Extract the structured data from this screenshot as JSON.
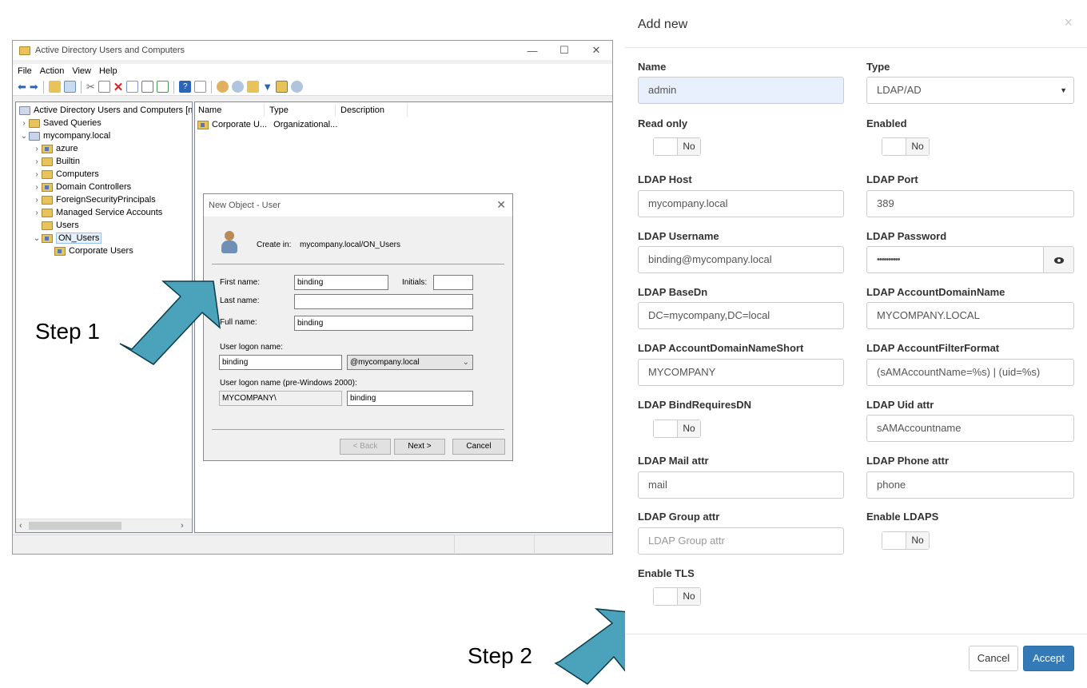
{
  "ad_window": {
    "title": "Active Directory Users and Computers",
    "menu": [
      "File",
      "Action",
      "View",
      "Help"
    ],
    "tree": {
      "root": "Active Directory Users and Computers [nc",
      "saved_queries": "Saved Queries",
      "domain": "mycompany.local",
      "children": [
        "azure",
        "Builtin",
        "Computers",
        "Domain Controllers",
        "ForeignSecurityPrincipals",
        "Managed Service Accounts",
        "Users",
        "ON_Users"
      ],
      "sub_child": "Corporate Users"
    },
    "list": {
      "columns": [
        "Name",
        "Type",
        "Description"
      ],
      "rows": [
        {
          "name": "Corporate U...",
          "type": "Organizational...",
          "description": ""
        }
      ]
    }
  },
  "new_object_dialog": {
    "title": "New Object - User",
    "create_in_label": "Create in:",
    "create_in_value": "mycompany.local/ON_Users",
    "first_name_label": "First name:",
    "first_name_value": "binding",
    "initials_label": "Initials:",
    "initials_value": "",
    "last_name_label": "Last name:",
    "last_name_value": "",
    "full_name_label": "Full name:",
    "full_name_value": "binding",
    "logon_label": "User logon name:",
    "logon_value": "binding",
    "logon_domain": "@mycompany.local",
    "prewin_label": "User logon name (pre-Windows 2000):",
    "prewin_domain": "MYCOMPANY\\",
    "prewin_value": "binding",
    "back_button": "< Back",
    "next_button": "Next >",
    "cancel_button": "Cancel"
  },
  "steps": {
    "step1": "Step 1",
    "step2": "Step 2"
  },
  "modal": {
    "title": "Add new",
    "close": "×",
    "fields": {
      "name": {
        "label": "Name",
        "value": "admin"
      },
      "type": {
        "label": "Type",
        "value": "LDAP/AD"
      },
      "read_only": {
        "label": "Read only",
        "value": "No"
      },
      "enabled": {
        "label": "Enabled",
        "value": "No"
      },
      "ldap_host": {
        "label": "LDAP Host",
        "value": "mycompany.local"
      },
      "ldap_port": {
        "label": "LDAP Port",
        "value": "389"
      },
      "ldap_username": {
        "label": "LDAP Username",
        "value": "binding@mycompany.local"
      },
      "ldap_password": {
        "label": "LDAP Password",
        "value": "••••••••••"
      },
      "ldap_basedn": {
        "label": "LDAP BaseDn",
        "value": "DC=mycompany,DC=local"
      },
      "ldap_account_domain_name": {
        "label": "LDAP AccountDomainName",
        "value": "MYCOMPANY.LOCAL"
      },
      "ldap_account_domain_name_short": {
        "label": "LDAP AccountDomainNameShort",
        "value": "MYCOMPANY"
      },
      "ldap_account_filter_format": {
        "label": "LDAP AccountFilterFormat",
        "value": "(sAMAccountName=%s) | (uid=%s)"
      },
      "ldap_bind_requires_dn": {
        "label": "LDAP BindRequiresDN",
        "value": "No"
      },
      "ldap_uid_attr": {
        "label": "LDAP Uid attr",
        "value": "sAMAccountname"
      },
      "ldap_mail_attr": {
        "label": "LDAP Mail attr",
        "value": "mail"
      },
      "ldap_phone_attr": {
        "label": "LDAP Phone attr",
        "value": "phone"
      },
      "ldap_group_attr": {
        "label": "LDAP Group attr",
        "placeholder": "LDAP Group attr"
      },
      "enable_ldaps": {
        "label": "Enable LDAPS",
        "value": "No"
      },
      "enable_tls": {
        "label": "Enable TLS",
        "value": "No"
      }
    },
    "cancel_button": "Cancel",
    "accept_button": "Accept"
  },
  "colors": {
    "accept": "#337ab7",
    "arrow": "#4aa3bb",
    "name_field_bg": "#e8f0fe"
  }
}
